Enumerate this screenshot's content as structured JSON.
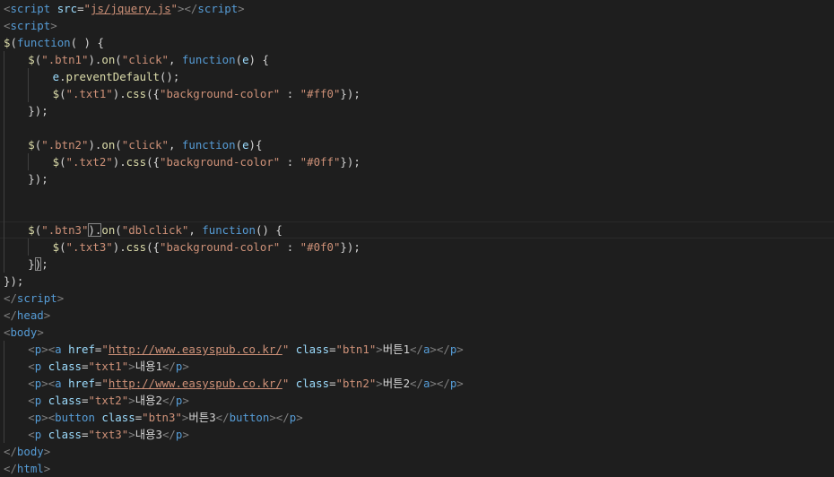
{
  "colors": {
    "background": "#1e1e1e",
    "tag": "#569cd6",
    "string": "#ce9178",
    "attribute": "#9cdcfe",
    "function": "#dcdcaa",
    "text": "#d4d4d4",
    "punctuation": "#808080"
  },
  "cursor": {
    "line": 15,
    "after_token": 3
  },
  "current_line": 13,
  "bracket_highlight": [
    {
      "line": 13,
      "token": 3
    },
    {
      "line": 15,
      "token": 1
    }
  ],
  "lines": [
    {
      "indent": 0,
      "tokens": [
        [
          "t-punc",
          "<"
        ],
        [
          "t-tag",
          "script "
        ],
        [
          "t-attr",
          "src"
        ],
        [
          "t-text",
          "="
        ],
        [
          "t-str",
          "\""
        ],
        [
          "t-link",
          "js/jquery.js"
        ],
        [
          "t-str",
          "\""
        ],
        [
          "t-punc",
          "></"
        ],
        [
          "t-tag",
          "script"
        ],
        [
          "t-punc",
          ">"
        ]
      ]
    },
    {
      "indent": 0,
      "tokens": [
        [
          "t-punc",
          "<"
        ],
        [
          "t-tag",
          "script"
        ],
        [
          "t-punc",
          ">"
        ]
      ]
    },
    {
      "indent": 0,
      "tokens": [
        [
          "t-fn",
          "$"
        ],
        [
          "t-text",
          "("
        ],
        [
          "t-kw",
          "function"
        ],
        [
          "t-text",
          "( ) {"
        ]
      ]
    },
    {
      "indent": 1,
      "tokens": [
        [
          "t-fn",
          "$"
        ],
        [
          "t-text",
          "("
        ],
        [
          "t-str",
          "\".btn1\""
        ],
        [
          "t-text",
          ")."
        ],
        [
          "t-fn",
          "on"
        ],
        [
          "t-text",
          "("
        ],
        [
          "t-str",
          "\"click\""
        ],
        [
          "t-text",
          ", "
        ],
        [
          "t-kw",
          "function"
        ],
        [
          "t-text",
          "("
        ],
        [
          "t-var",
          "e"
        ],
        [
          "t-text",
          ") {"
        ]
      ]
    },
    {
      "indent": 2,
      "tokens": [
        [
          "t-var",
          "e"
        ],
        [
          "t-text",
          "."
        ],
        [
          "t-fn",
          "preventDefault"
        ],
        [
          "t-text",
          "();"
        ]
      ]
    },
    {
      "indent": 2,
      "tokens": [
        [
          "t-fn",
          "$"
        ],
        [
          "t-text",
          "("
        ],
        [
          "t-str",
          "\".txt1\""
        ],
        [
          "t-text",
          ")."
        ],
        [
          "t-fn",
          "css"
        ],
        [
          "t-text",
          "({"
        ],
        [
          "t-str",
          "\"background-color\""
        ],
        [
          "t-text",
          " : "
        ],
        [
          "t-str",
          "\"#ff0\""
        ],
        [
          "t-text",
          "});"
        ]
      ]
    },
    {
      "indent": 1,
      "tokens": [
        [
          "t-text",
          "});"
        ]
      ]
    },
    {
      "indent": 0,
      "tokens": []
    },
    {
      "indent": 1,
      "tokens": [
        [
          "t-fn",
          "$"
        ],
        [
          "t-text",
          "("
        ],
        [
          "t-str",
          "\".btn2\""
        ],
        [
          "t-text",
          ")."
        ],
        [
          "t-fn",
          "on"
        ],
        [
          "t-text",
          "("
        ],
        [
          "t-str",
          "\"click\""
        ],
        [
          "t-text",
          ", "
        ],
        [
          "t-kw",
          "function"
        ],
        [
          "t-text",
          "("
        ],
        [
          "t-var",
          "e"
        ],
        [
          "t-text",
          "){"
        ]
      ]
    },
    {
      "indent": 2,
      "tokens": [
        [
          "t-fn",
          "$"
        ],
        [
          "t-text",
          "("
        ],
        [
          "t-str",
          "\".txt2\""
        ],
        [
          "t-text",
          ")."
        ],
        [
          "t-fn",
          "css"
        ],
        [
          "t-text",
          "({"
        ],
        [
          "t-str",
          "\"background-color\""
        ],
        [
          "t-text",
          " : "
        ],
        [
          "t-str",
          "\"#0ff\""
        ],
        [
          "t-text",
          "});"
        ]
      ]
    },
    {
      "indent": 1,
      "tokens": [
        [
          "t-text",
          "});"
        ]
      ]
    },
    {
      "indent": 0,
      "tokens": []
    },
    {
      "indent": 0,
      "tokens": []
    },
    {
      "indent": 1,
      "tokens": [
        [
          "t-fn",
          "$"
        ],
        [
          "t-text",
          "("
        ],
        [
          "t-str",
          "\".btn3\""
        ],
        [
          "t-text",
          ")."
        ],
        [
          "t-fn",
          "on"
        ],
        [
          "t-text",
          "("
        ],
        [
          "t-str",
          "\"dblclick\""
        ],
        [
          "t-text",
          ", "
        ],
        [
          "t-kw",
          "function"
        ],
        [
          "t-text",
          "() {"
        ]
      ]
    },
    {
      "indent": 2,
      "tokens": [
        [
          "t-fn",
          "$"
        ],
        [
          "t-text",
          "("
        ],
        [
          "t-str",
          "\".txt3\""
        ],
        [
          "t-text",
          ")."
        ],
        [
          "t-fn",
          "css"
        ],
        [
          "t-text",
          "({"
        ],
        [
          "t-str",
          "\"background-color\""
        ],
        [
          "t-text",
          " : "
        ],
        [
          "t-str",
          "\"#0f0\""
        ],
        [
          "t-text",
          "});"
        ]
      ]
    },
    {
      "indent": 1,
      "tokens": [
        [
          "t-text",
          "}"
        ],
        [
          "t-text",
          ")"
        ],
        [
          "t-text",
          ";"
        ]
      ]
    },
    {
      "indent": 0,
      "tokens": [
        [
          "t-text",
          "});"
        ]
      ]
    },
    {
      "indent": 0,
      "tokens": [
        [
          "t-punc",
          "</"
        ],
        [
          "t-tag",
          "script"
        ],
        [
          "t-punc",
          ">"
        ]
      ]
    },
    {
      "indent": 0,
      "tokens": [
        [
          "t-punc",
          "</"
        ],
        [
          "t-tag",
          "head"
        ],
        [
          "t-punc",
          ">"
        ]
      ]
    },
    {
      "indent": 0,
      "tokens": [
        [
          "t-punc",
          "<"
        ],
        [
          "t-tag",
          "body"
        ],
        [
          "t-punc",
          ">"
        ]
      ]
    },
    {
      "indent": 1,
      "tokens": [
        [
          "t-punc",
          "<"
        ],
        [
          "t-tag",
          "p"
        ],
        [
          "t-punc",
          "><"
        ],
        [
          "t-tag",
          "a "
        ],
        [
          "t-attr",
          "href"
        ],
        [
          "t-text",
          "="
        ],
        [
          "t-str",
          "\""
        ],
        [
          "t-link",
          "http://www.easyspub.co.kr/"
        ],
        [
          "t-str",
          "\""
        ],
        [
          "t-attr",
          " class"
        ],
        [
          "t-text",
          "="
        ],
        [
          "t-str",
          "\"btn1\""
        ],
        [
          "t-punc",
          ">"
        ],
        [
          "t-text",
          "버튼1"
        ],
        [
          "t-punc",
          "</"
        ],
        [
          "t-tag",
          "a"
        ],
        [
          "t-punc",
          "></"
        ],
        [
          "t-tag",
          "p"
        ],
        [
          "t-punc",
          ">"
        ]
      ]
    },
    {
      "indent": 1,
      "tokens": [
        [
          "t-punc",
          "<"
        ],
        [
          "t-tag",
          "p "
        ],
        [
          "t-attr",
          "class"
        ],
        [
          "t-text",
          "="
        ],
        [
          "t-str",
          "\"txt1\""
        ],
        [
          "t-punc",
          ">"
        ],
        [
          "t-text",
          "내용1"
        ],
        [
          "t-punc",
          "</"
        ],
        [
          "t-tag",
          "p"
        ],
        [
          "t-punc",
          ">"
        ]
      ]
    },
    {
      "indent": 1,
      "tokens": [
        [
          "t-punc",
          "<"
        ],
        [
          "t-tag",
          "p"
        ],
        [
          "t-punc",
          "><"
        ],
        [
          "t-tag",
          "a "
        ],
        [
          "t-attr",
          "href"
        ],
        [
          "t-text",
          "="
        ],
        [
          "t-str",
          "\""
        ],
        [
          "t-link",
          "http://www.easyspub.co.kr/"
        ],
        [
          "t-str",
          "\""
        ],
        [
          "t-attr",
          " class"
        ],
        [
          "t-text",
          "="
        ],
        [
          "t-str",
          "\"btn2\""
        ],
        [
          "t-punc",
          ">"
        ],
        [
          "t-text",
          "버튼2"
        ],
        [
          "t-punc",
          "</"
        ],
        [
          "t-tag",
          "a"
        ],
        [
          "t-punc",
          "></"
        ],
        [
          "t-tag",
          "p"
        ],
        [
          "t-punc",
          ">"
        ]
      ]
    },
    {
      "indent": 1,
      "tokens": [
        [
          "t-punc",
          "<"
        ],
        [
          "t-tag",
          "p "
        ],
        [
          "t-attr",
          "class"
        ],
        [
          "t-text",
          "="
        ],
        [
          "t-str",
          "\"txt2\""
        ],
        [
          "t-punc",
          ">"
        ],
        [
          "t-text",
          "내용2"
        ],
        [
          "t-punc",
          "</"
        ],
        [
          "t-tag",
          "p"
        ],
        [
          "t-punc",
          ">"
        ]
      ]
    },
    {
      "indent": 1,
      "tokens": [
        [
          "t-punc",
          "<"
        ],
        [
          "t-tag",
          "p"
        ],
        [
          "t-punc",
          "><"
        ],
        [
          "t-tag",
          "button "
        ],
        [
          "t-attr",
          "class"
        ],
        [
          "t-text",
          "="
        ],
        [
          "t-str",
          "\"btn3\""
        ],
        [
          "t-punc",
          ">"
        ],
        [
          "t-text",
          "버튼3"
        ],
        [
          "t-punc",
          "</"
        ],
        [
          "t-tag",
          "button"
        ],
        [
          "t-punc",
          "></"
        ],
        [
          "t-tag",
          "p"
        ],
        [
          "t-punc",
          ">"
        ]
      ]
    },
    {
      "indent": 1,
      "tokens": [
        [
          "t-punc",
          "<"
        ],
        [
          "t-tag",
          "p "
        ],
        [
          "t-attr",
          "class"
        ],
        [
          "t-text",
          "="
        ],
        [
          "t-str",
          "\"txt3\""
        ],
        [
          "t-punc",
          ">"
        ],
        [
          "t-text",
          "내용3"
        ],
        [
          "t-punc",
          "</"
        ],
        [
          "t-tag",
          "p"
        ],
        [
          "t-punc",
          ">"
        ]
      ]
    },
    {
      "indent": 0,
      "tokens": [
        [
          "t-punc",
          "</"
        ],
        [
          "t-tag",
          "body"
        ],
        [
          "t-punc",
          ">"
        ]
      ]
    },
    {
      "indent": 0,
      "tokens": [
        [
          "t-punc",
          "</"
        ],
        [
          "t-tag",
          "html"
        ],
        [
          "t-punc",
          ">"
        ]
      ]
    }
  ]
}
